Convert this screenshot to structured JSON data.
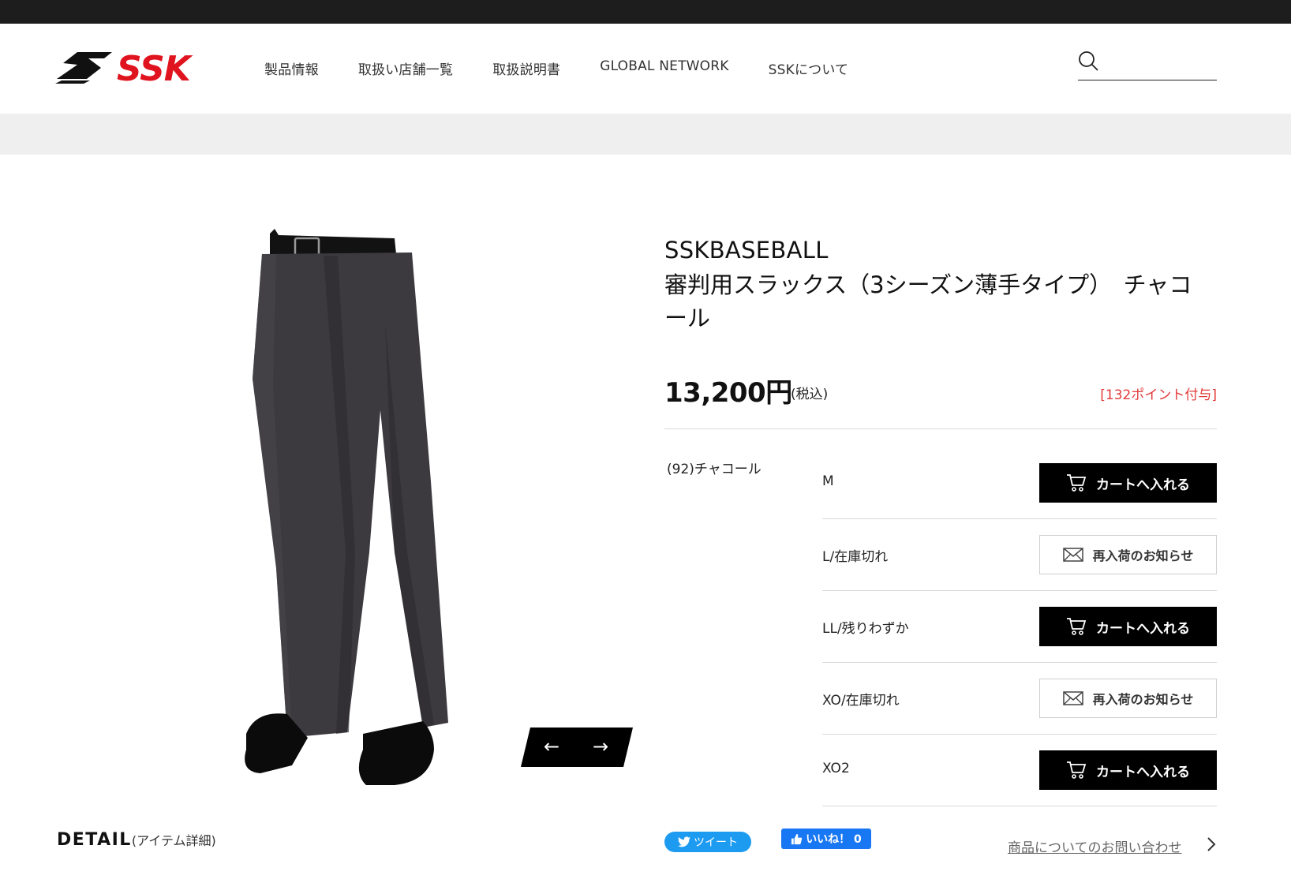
{
  "header": {
    "logo_text": "SSK",
    "nav": [
      "製品情報",
      "取扱い店舗一覧",
      "取扱説明書",
      "GLOBAL NETWORK",
      "SSKについて"
    ],
    "search_placeholder": ""
  },
  "product": {
    "brand": "SSKBASEBALL",
    "title": "審判用スラックス（3シーズン薄手タイプ）　チャコール",
    "price": "13,200円",
    "tax": "(税込)",
    "points": "[132ポイント付与]",
    "color": "(92)チャコール",
    "sizes": [
      {
        "label": "M",
        "button": "カートへ入れる",
        "type": "cart"
      },
      {
        "label": "L/在庫切れ",
        "button": "再入荷のお知らせ",
        "type": "notify"
      },
      {
        "label": "LL/残りわずか",
        "button": "カートへ入れる",
        "type": "cart"
      },
      {
        "label": "XO/在庫切れ",
        "button": "再入荷のお知らせ",
        "type": "notify"
      },
      {
        "label": "XO2",
        "button": "カートへ入れる",
        "type": "cart"
      }
    ],
    "image_color": "#3c3a3f"
  },
  "slider": {
    "prev": "←",
    "next": "→"
  },
  "footer": {
    "detail": "DETAIL",
    "detail_sub": "(アイテム詳細)",
    "tweet": "ツイート",
    "like": "いいね！ 0",
    "inquiry": "商品についてのお問い合わせ"
  },
  "colors": {
    "accent_red": "#e23b3b",
    "logo_red": "#e0141e",
    "black": "#000000"
  }
}
